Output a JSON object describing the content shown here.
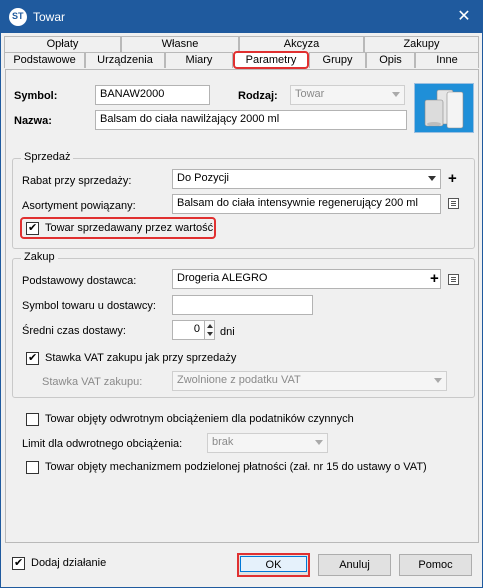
{
  "window": {
    "title": "Towar",
    "app_icon": "app-logo-icon",
    "close_icon": "close-icon"
  },
  "tabs": {
    "row1": [
      "Opłaty",
      "Własne",
      "Akcyza",
      "Zakupy"
    ],
    "row2": [
      "Podstawowe",
      "Urządzenia",
      "Miary",
      "Parametry",
      "Grupy",
      "Opis",
      "Inne"
    ],
    "active": "Parametry"
  },
  "header": {
    "symbol_label": "Symbol:",
    "symbol_value": "BANAW2000",
    "rodzaj_label": "Rodzaj:",
    "rodzaj_value": "Towar",
    "nazwa_label": "Nazwa:",
    "nazwa_value": "Balsam do ciała nawilżający 2000 ml"
  },
  "sprzedaz": {
    "title": "Sprzedaż",
    "rabat_label": "Rabat przy sprzedaży:",
    "rabat_value": "Do Pozycji",
    "asortyment_label": "Asortyment powiązany:",
    "asortyment_value": "Balsam do ciała intensywnie regenerujący 200 ml",
    "wartosc_label": "Towar sprzedawany przez wartość",
    "wartosc_checked": true
  },
  "zakup": {
    "title": "Zakup",
    "dostawca_label": "Podstawowy dostawca:",
    "dostawca_value": "Drogeria ALEGRO",
    "symbol_dost_label": "Symbol towaru u dostawcy:",
    "symbol_dost_value": "",
    "czas_label": "Średni czas dostawy:",
    "czas_value": "0",
    "czas_unit": "dni",
    "vat_same_label": "Stawka VAT zakupu jak przy sprzedaży",
    "vat_same_checked": true,
    "vat_label": "Stawka VAT zakupu:",
    "vat_value": "Zwolnione z podatku VAT"
  },
  "other": {
    "odwrotne_label": "Towar objęty odwrotnym obciążeniem dla podatników czynnych",
    "limit_label": "Limit dla odwrotnego obciążenia:",
    "limit_value": "brak",
    "podzielona_label": "Towar objęty mechanizmem podzielonej płatności (zał. nr 15 do ustawy o VAT)"
  },
  "footer": {
    "dodaj_label": "Dodaj działanie",
    "dodaj_checked": true,
    "ok": "OK",
    "anuluj": "Anuluj",
    "pomoc": "Pomoc"
  },
  "colors": {
    "titlebar": "#1f5a9e",
    "highlight": "#e03030"
  }
}
